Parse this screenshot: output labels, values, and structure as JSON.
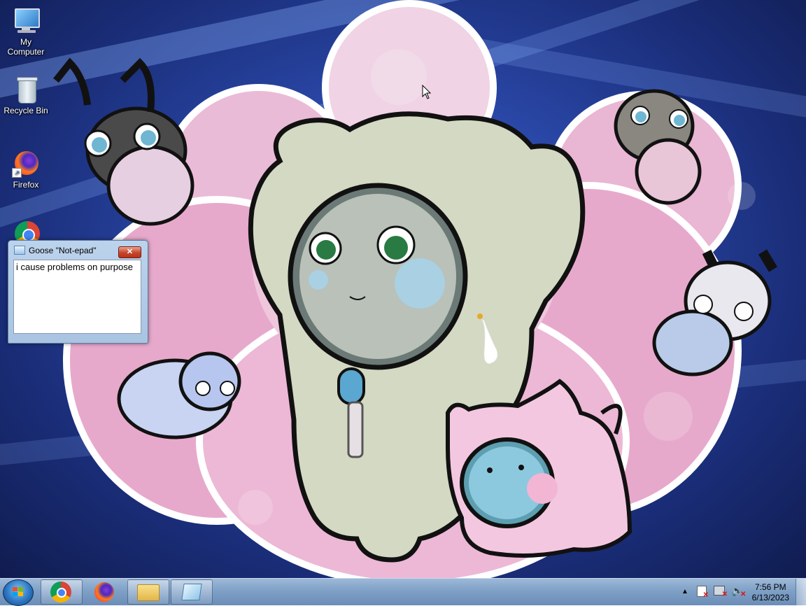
{
  "desktop": {
    "icons": [
      {
        "label": "My Computer",
        "icon": "computer-icon"
      },
      {
        "label": "Recycle Bin",
        "icon": "recycle-bin-icon"
      },
      {
        "label": "Firefox",
        "icon": "firefox-icon"
      },
      {
        "label": "",
        "icon": "chrome-icon"
      }
    ]
  },
  "notepad": {
    "title": "Goose \"Not-epad\"",
    "close_label": "✕",
    "content": "i cause problems on purpose"
  },
  "taskbar": {
    "buttons": [
      {
        "name": "chrome",
        "icon": "chrome-icon",
        "active": true
      },
      {
        "name": "firefox",
        "icon": "firefox-icon",
        "active": false
      },
      {
        "name": "file-explorer",
        "icon": "folder-icon",
        "active": false
      },
      {
        "name": "notepad",
        "icon": "notepad-icon",
        "active": true
      }
    ],
    "tray": {
      "time": "7:56 PM",
      "date": "6/13/2023"
    }
  },
  "colors": {
    "accent": "#2d77c4",
    "taskbar": "#7fa0c6",
    "close_button": "#c7452b"
  }
}
